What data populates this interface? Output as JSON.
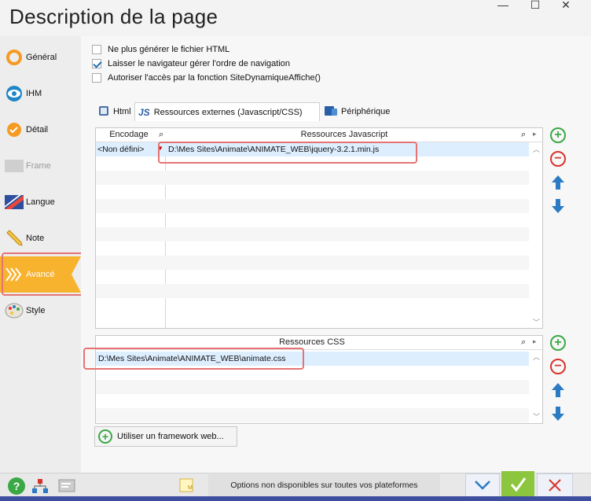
{
  "window": {
    "title": "Description de la page",
    "minimize_glyph": "—",
    "maximize_glyph": "☐",
    "close_glyph": "✕"
  },
  "sidebar": {
    "items": [
      {
        "label": "Général",
        "icon": "orange-circle-icon"
      },
      {
        "label": "IHM",
        "icon": "eye-icon"
      },
      {
        "label": "Détail",
        "icon": "orange-check-circle-icon"
      },
      {
        "label": "Frame",
        "icon": "frame-icon",
        "disabled": true
      },
      {
        "label": "Langue",
        "icon": "flag-icon"
      },
      {
        "label": "Note",
        "icon": "pencil-icon"
      },
      {
        "label": "Avancé",
        "icon": "chevrons-icon",
        "active": true
      },
      {
        "label": "Style",
        "icon": "palette-icon"
      }
    ]
  },
  "options": {
    "no_html": "Ne plus générer le fichier HTML",
    "nav_order": "Laisser le navigateur gérer l'ordre de navigation",
    "site_access": "Autoriser l'accès par la fonction SiteDynamiqueAffiche()"
  },
  "tabs": {
    "html": "Html",
    "external": "Ressources externes (Javascript/CSS)",
    "device": "Périphérique",
    "js_badge": "JS"
  },
  "js_table": {
    "col_encoding": "Encodage",
    "col_resources": "Ressources Javascript",
    "row_encoding": "<Non défini>",
    "row_path": "D:\\Mes Sites\\Animate\\ANIMATE_WEB\\jquery-3.2.1.min.js"
  },
  "css_table": {
    "col_resources": "Ressources CSS",
    "row_path": "D:\\Mes Sites\\Animate\\ANIMATE_WEB\\animate.css"
  },
  "framework_button": "Utiliser un framework web...",
  "footer": {
    "note": "Options non disponibles sur toutes vos plateformes",
    "help": "?"
  },
  "colors": {
    "accent_orange": "#f7b22e",
    "highlight_red": "#e57373",
    "add_green": "#3aa845",
    "remove_red": "#d9322b",
    "arrow_blue": "#2a7bc4",
    "ok_green": "#8cc63f"
  }
}
